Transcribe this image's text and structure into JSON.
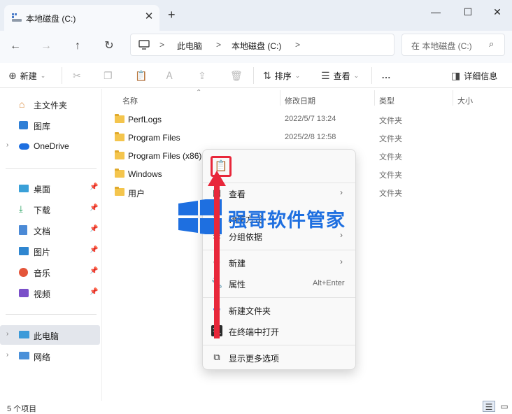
{
  "window": {
    "tab_title": "本地磁盘 (C:)",
    "tab_close": "✕",
    "new_tab": "+",
    "minimize": "—",
    "maximize": "☐",
    "close": "✕"
  },
  "address": {
    "crumbs": [
      "此电脑",
      "本地磁盘 (C:)"
    ],
    "separator": ">",
    "search_placeholder": "在 本地磁盘 (C:)"
  },
  "toolbar": {
    "new_label": "新建",
    "sort_label": "排序",
    "view_label": "查看",
    "more_label": "...",
    "details_label": "详细信息"
  },
  "sidebar": {
    "top_items": [
      {
        "label": "主文件夹",
        "icon": "home-icon"
      },
      {
        "label": "图库",
        "icon": "gallery-icon"
      },
      {
        "label": "OneDrive",
        "icon": "cloud-icon"
      }
    ],
    "quick_items": [
      {
        "label": "桌面",
        "icon": "desktop-icon"
      },
      {
        "label": "下载",
        "icon": "download-icon"
      },
      {
        "label": "文档",
        "icon": "document-icon"
      },
      {
        "label": "图片",
        "icon": "picture-icon"
      },
      {
        "label": "音乐",
        "icon": "music-icon"
      },
      {
        "label": "视频",
        "icon": "video-icon"
      }
    ],
    "bottom_items": [
      {
        "label": "此电脑",
        "icon": "computer-icon"
      },
      {
        "label": "网络",
        "icon": "network-icon"
      }
    ]
  },
  "columns": {
    "name": "名称",
    "modified": "修改日期",
    "type": "类型",
    "size": "大小"
  },
  "files": [
    {
      "name": "PerfLogs",
      "date": "2022/5/7 13:24",
      "type": "文件夹"
    },
    {
      "name": "Program Files",
      "date": "2025/2/8 12:58",
      "type": "文件夹"
    },
    {
      "name": "Program Files (x86)",
      "date": "",
      "type": "文件夹"
    },
    {
      "name": "Windows",
      "date": "",
      "type": "文件夹"
    },
    {
      "name": "用户",
      "date": "",
      "type": "文件夹"
    }
  ],
  "status": {
    "count": "5 个项目"
  },
  "context_menu": {
    "items": [
      {
        "label": "查看",
        "icon": "view-icon",
        "arrow": "›"
      },
      {
        "label": "排序方式",
        "icon": "sort-icon",
        "arrow": "›"
      },
      {
        "label": "分组依据",
        "icon": "group-icon",
        "arrow": "›"
      },
      {
        "label": "新建",
        "icon": "plus-circle-icon",
        "arrow": "›"
      },
      {
        "label": "属性",
        "icon": "wrench-icon",
        "shortcut": "Alt+Enter"
      },
      {
        "label": "新建文件夹",
        "icon": "new-folder-icon"
      },
      {
        "label": "在终端中打开",
        "icon": "terminal-icon"
      },
      {
        "label": "显示更多选项",
        "icon": "more-options-icon"
      }
    ]
  },
  "watermark": {
    "text": "强哥软件管家"
  },
  "colors": {
    "accent": "#1e6fe0",
    "highlight_red": "#e8273a",
    "folder": "#f4c54d"
  }
}
